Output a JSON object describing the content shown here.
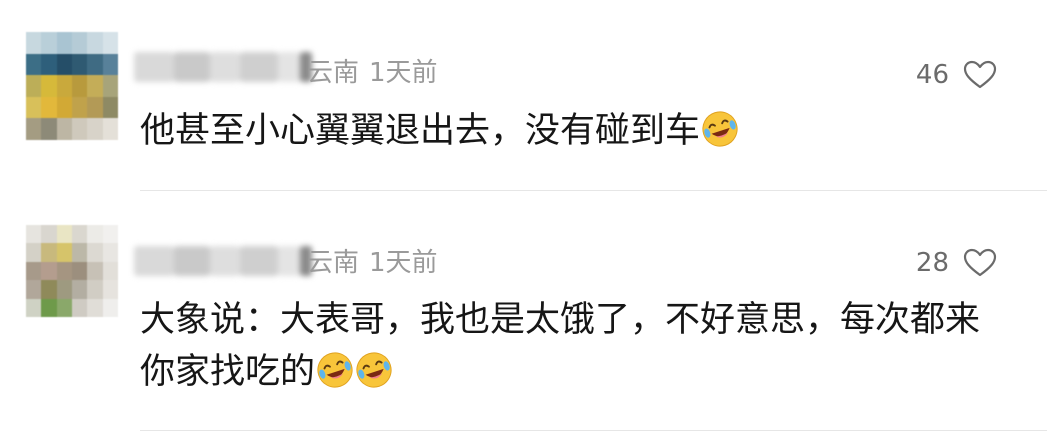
{
  "comments": [
    {
      "location": "云南",
      "time": "1天前",
      "likes": "46",
      "text": "他甚至小心翼翼退出去，没有碰到车",
      "emoji_count": 1,
      "emoji_icon": "laugh-cry-emoji-icon"
    },
    {
      "location": "云南",
      "time": "1天前",
      "likes": "28",
      "text": "大象说：大表哥，我也是太饿了，不好意思，每次都来你家找吃的",
      "emoji_count": 2,
      "emoji_icon": "laugh-cry-emoji-icon"
    }
  ],
  "colors": {
    "meta_gray": "#9a9a9a",
    "likes_gray": "#6b6b6b",
    "text": "#161616",
    "divider": "#e6e6e6"
  }
}
